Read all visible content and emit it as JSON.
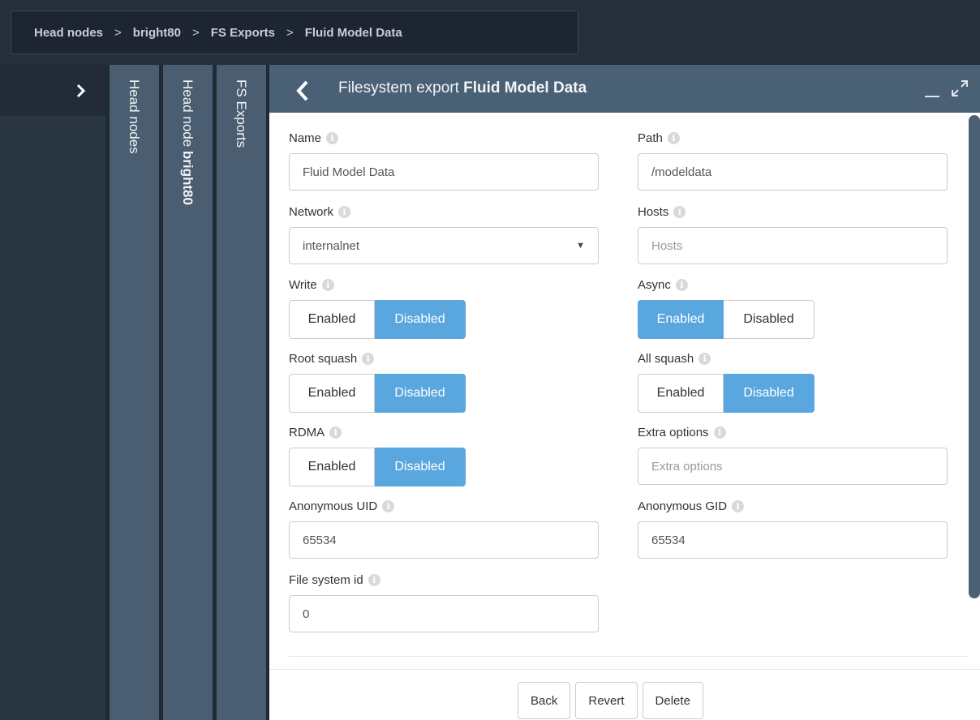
{
  "breadcrumb": [
    "Head nodes",
    "bright80",
    "FS Exports",
    "Fluid Model Data"
  ],
  "breadcrumb_separator": ">",
  "left_column": {
    "expand_icon": "chevron-right-icon"
  },
  "panels": {
    "head_nodes": "Head nodes",
    "head_node_prefix": "Head node ",
    "head_node_name": "bright80",
    "fs_exports": "FS Exports"
  },
  "header": {
    "title_prefix": "Filesystem export ",
    "title_name": "Fluid Model Data"
  },
  "fields": {
    "name": {
      "label": "Name",
      "value": "Fluid Model Data"
    },
    "path": {
      "label": "Path",
      "value": "/modeldata"
    },
    "network": {
      "label": "Network",
      "value": "internalnet"
    },
    "hosts": {
      "label": "Hosts",
      "placeholder": "Hosts"
    },
    "write": {
      "label": "Write",
      "enabled": "Enabled",
      "disabled": "Disabled",
      "selected": "Disabled"
    },
    "async": {
      "label": "Async",
      "enabled": "Enabled",
      "disabled": "Disabled",
      "selected": "Enabled"
    },
    "root_squash": {
      "label": "Root squash",
      "enabled": "Enabled",
      "disabled": "Disabled",
      "selected": "Disabled"
    },
    "all_squash": {
      "label": "All squash",
      "enabled": "Enabled",
      "disabled": "Disabled",
      "selected": "Disabled"
    },
    "rdma": {
      "label": "RDMA",
      "enabled": "Enabled",
      "disabled": "Disabled",
      "selected": "Disabled"
    },
    "extra_options": {
      "label": "Extra options",
      "placeholder": "Extra options"
    },
    "anon_uid": {
      "label": "Anonymous UID",
      "value": "65534"
    },
    "anon_gid": {
      "label": "Anonymous GID",
      "value": "65534"
    },
    "fsid": {
      "label": "File system id",
      "value": "0"
    }
  },
  "footer": {
    "back": "Back",
    "revert": "Revert",
    "delete": "Delete"
  },
  "colors": {
    "accent": "#5aa7df",
    "panel": "#4a5d71",
    "header": "#4a6075",
    "background": "#1f2a36"
  }
}
